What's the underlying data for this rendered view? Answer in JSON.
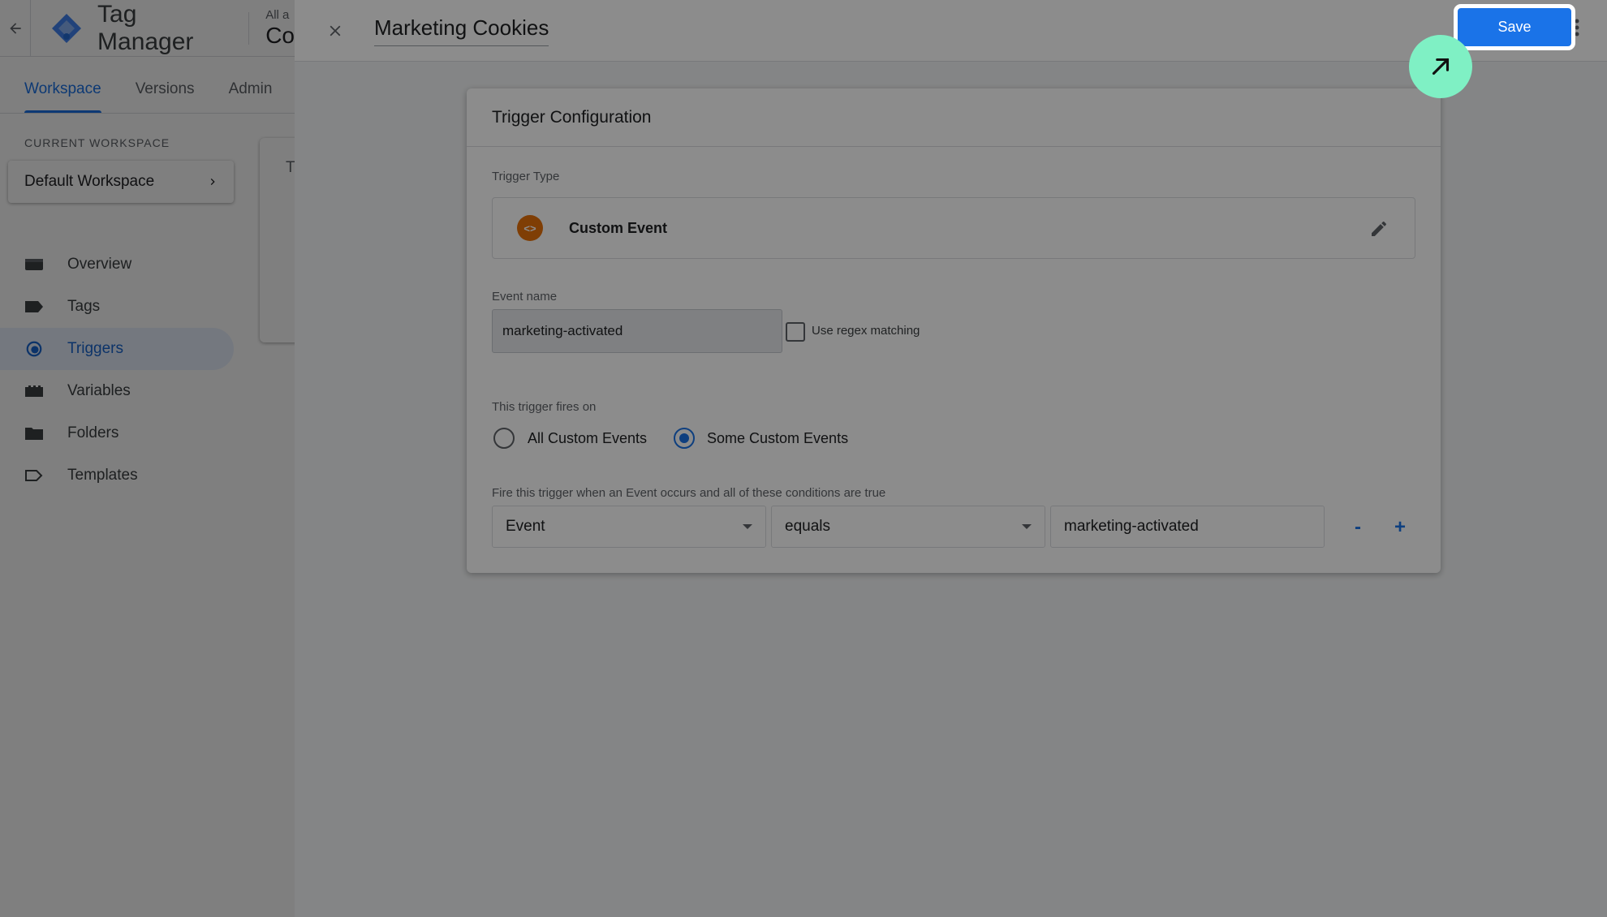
{
  "background": {
    "app_name": "Tag Manager",
    "account_small": "All a",
    "account_big": "Co",
    "tabs": [
      {
        "label": "Workspace",
        "active": true
      },
      {
        "label": "Versions",
        "active": false
      },
      {
        "label": "Admin",
        "active": false
      }
    ],
    "workspace_label": "CURRENT WORKSPACE",
    "workspace_name": "Default Workspace",
    "nav": [
      {
        "label": "Overview",
        "icon": "overview-icon",
        "active": false
      },
      {
        "label": "Tags",
        "icon": "tag-icon",
        "active": false
      },
      {
        "label": "Triggers",
        "icon": "trigger-icon",
        "active": true
      },
      {
        "label": "Variables",
        "icon": "variables-icon",
        "active": false
      },
      {
        "label": "Folders",
        "icon": "folder-icon",
        "active": false
      },
      {
        "label": "Templates",
        "icon": "template-icon",
        "active": false
      }
    ],
    "card_text": "T"
  },
  "editor": {
    "title": "Marketing Cookies",
    "save_label": "Save",
    "card_title": "Trigger Configuration",
    "trigger_type_label": "Trigger Type",
    "trigger_type_name": "Custom Event",
    "trigger_type_icon_glyph": "<>",
    "event_name_label": "Event name",
    "event_name_value": "marketing-activated",
    "regex_label": "Use regex matching",
    "regex_checked": false,
    "fires_on_label": "This trigger fires on",
    "fires_on_options": [
      {
        "label": "All Custom Events",
        "checked": false
      },
      {
        "label": "Some Custom Events",
        "checked": true
      }
    ],
    "condition_label": "Fire this trigger when an Event occurs and all of these conditions are true",
    "condition": {
      "variable": "Event",
      "operator": "equals",
      "value": "marketing-activated"
    },
    "remove_label": "-",
    "add_label": "+"
  },
  "colors": {
    "accent": "#1a73e8",
    "trigger_icon": "#e8710a",
    "cursor_hint": "#7ff0c4"
  }
}
